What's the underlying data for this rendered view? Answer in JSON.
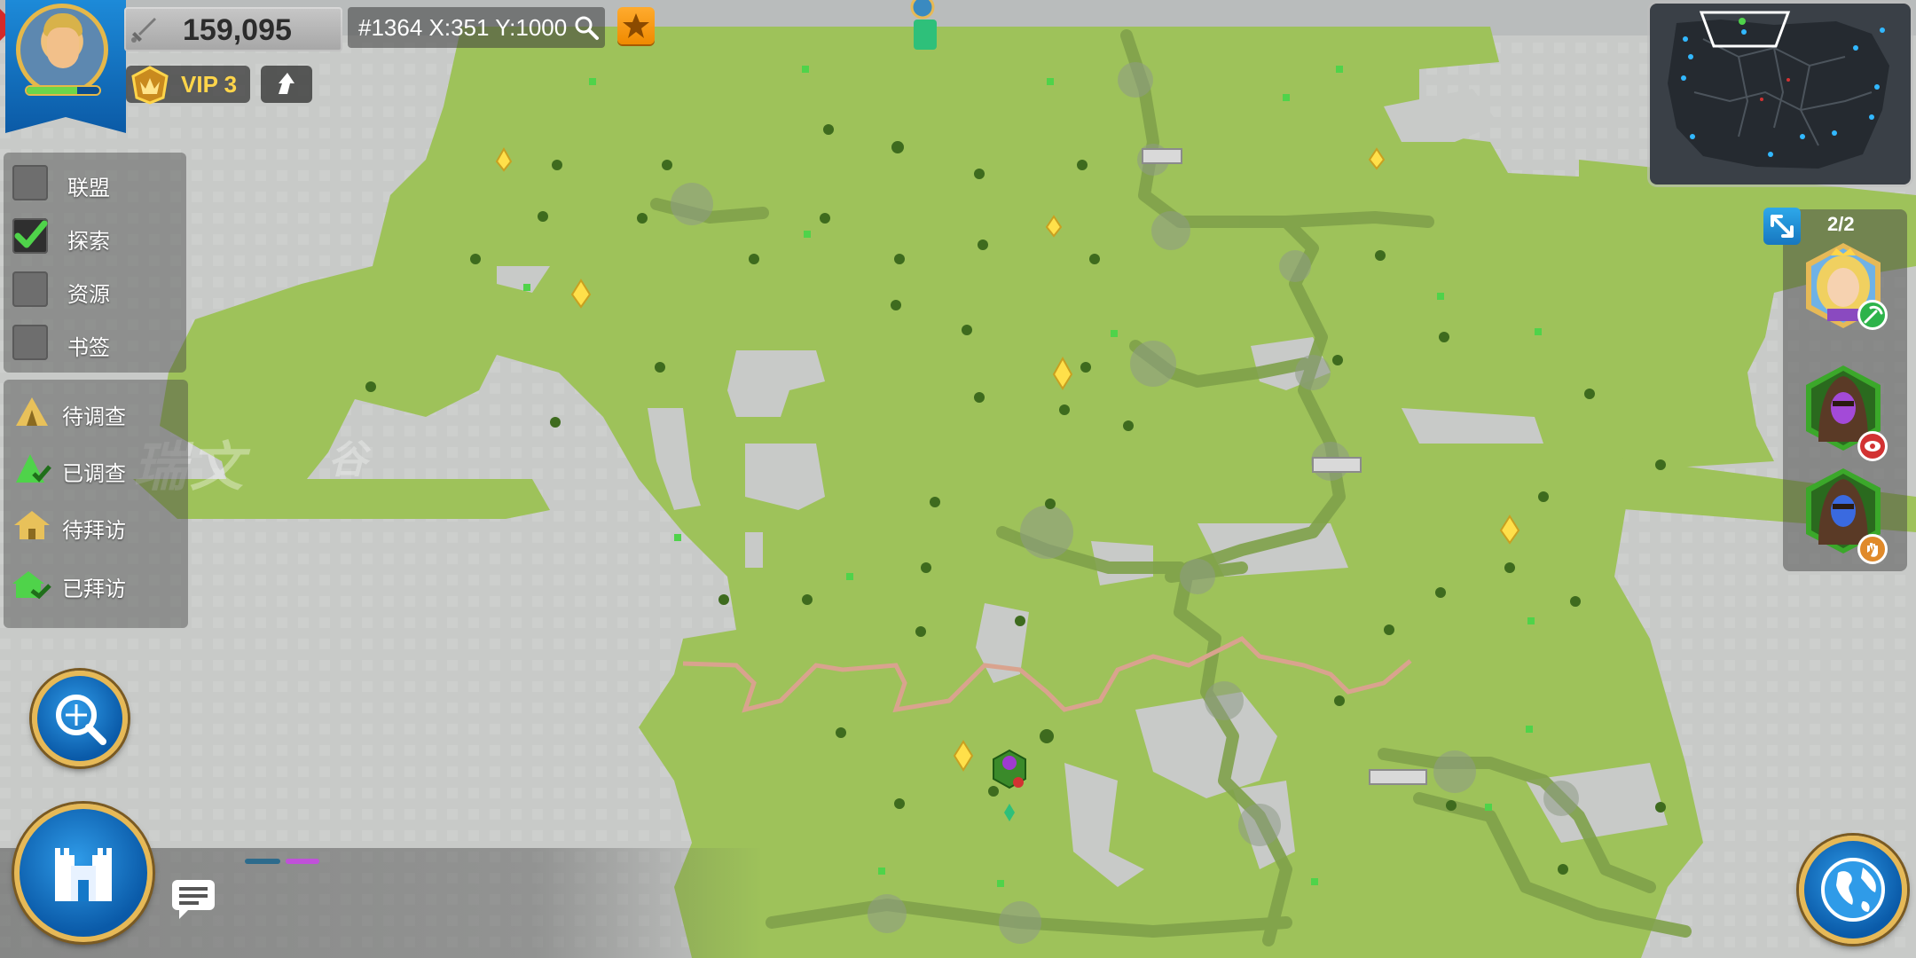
{
  "player": {
    "power": "159,095",
    "vip_label": "VIP 3",
    "exp_fill": 0.7
  },
  "location": {
    "coords": "#1364 X:351 Y:1000"
  },
  "filters": [
    {
      "label": "联盟",
      "checked": false
    },
    {
      "label": "探索",
      "checked": true
    },
    {
      "label": "资源",
      "checked": false
    },
    {
      "label": "书签",
      "checked": false
    }
  ],
  "legend": [
    {
      "label": "待调查",
      "icon": "tent-icon",
      "color": "#e8c15a"
    },
    {
      "label": "已调查",
      "icon": "tent-check-icon",
      "color": "#4fd34a"
    },
    {
      "label": "待拜访",
      "icon": "village-icon",
      "color": "#e8c15a"
    },
    {
      "label": "已拜访",
      "icon": "village-check-icon",
      "color": "#4fd34a"
    }
  ],
  "map": {
    "region_label_1": "瑞文",
    "region_label_2": "谷"
  },
  "troops": {
    "count": "2/2",
    "heroes": [
      {
        "name": "princess-hero",
        "action": "gathering",
        "action_icon": "pickaxe-icon",
        "badge_color": "#2db34a"
      },
      {
        "name": "scout-purple",
        "action": "scouting",
        "action_icon": "eye-icon",
        "badge_color": "#d23232"
      },
      {
        "name": "scout-blue",
        "action": "investigating",
        "action_icon": "hand-icon",
        "badge_color": "#e08a2a"
      }
    ]
  },
  "colors": {
    "grass": "#9ec25a",
    "fog": "#c8cac8",
    "button_blue": "#1478c8",
    "gold_border": "#e6b957",
    "vip_gold": "#ffd54a"
  }
}
